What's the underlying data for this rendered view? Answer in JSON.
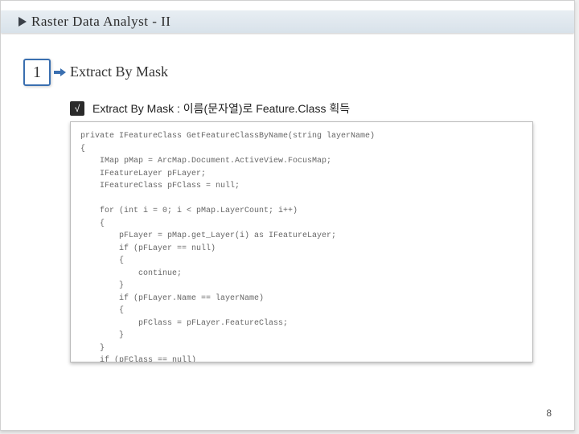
{
  "title": "Raster Data Analyst - II",
  "step_number": "1",
  "section_title": "Extract By Mask",
  "check_mark": "√",
  "sub_text": "Extract By Mask : 이름(문자열)로 Feature.Class 획득",
  "code": "private IFeatureClass GetFeatureClassByName(string layerName)\n{\n    IMap pMap = ArcMap.Document.ActiveView.FocusMap;\n    IFeatureLayer pFLayer;\n    IFeatureClass pFClass = null;\n\n    for (int i = 0; i < pMap.LayerCount; i++)\n    {\n        pFLayer = pMap.get_Layer(i) as IFeatureLayer;\n        if (pFLayer == null)\n        {\n            continue;\n        }\n        if (pFLayer.Name == layerName)\n        {\n            pFClass = pFLayer.FeatureClass;\n        }\n    }\n    if (pFClass == null)\n    {\n        MessageBox.Show(layerName + \" layer is not exist.\");\n    }\n    return pFClass;\n}",
  "page_number": "8"
}
